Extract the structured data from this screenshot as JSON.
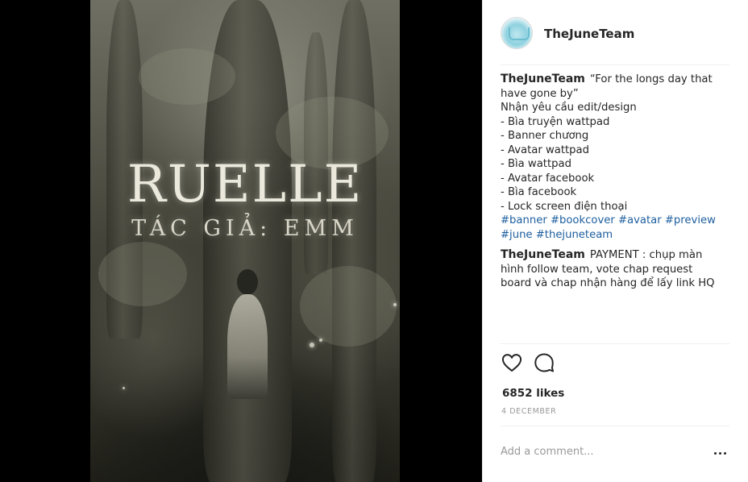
{
  "post": {
    "image": {
      "alt_semantic": "book-cover-image",
      "title_text": "RUELLE",
      "subtitle_text": "TÁC GIẢ: EMM"
    },
    "author": {
      "username": "TheJuneTeam"
    },
    "caption": {
      "user": "TheJuneTeam",
      "text": "“For the longs day that have gone by”\nNhận yêu cầu edit/design\n- Bìa truyện wattpad\n- Banner chương\n- Avatar wattpad\n- Bìa wattpad\n- Avatar facebook\n- Bìa facebook\n- Lock screen điện thoại",
      "hashtags": "#banner #bookcover #avatar #preview #june #thejuneteam"
    },
    "comments": [
      {
        "user": "TheJuneTeam",
        "text": "PAYMENT : chụp màn hình follow team, vote chap request board và chap nhận hàng để lấy link HQ"
      }
    ],
    "likes_text": "6852 likes",
    "date_text": "4 December",
    "add_comment_placeholder": "Add a comment...",
    "icons": {
      "like": "heart-icon",
      "comment": "comment-bubble-icon",
      "more": "more-options-icon"
    },
    "colors": {
      "hashtag": "#1d5e9e",
      "muted": "#999999",
      "text": "#262626"
    }
  }
}
